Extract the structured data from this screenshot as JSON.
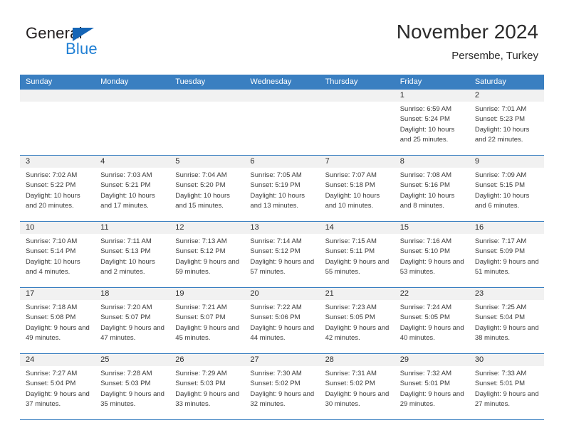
{
  "brand": {
    "name_part1": "General",
    "name_part2": "Blue",
    "triangle_color": "#1565b6",
    "blue_text_color": "#1f7fd4"
  },
  "header": {
    "title": "November 2024",
    "subtitle": "Persembe, Turkey",
    "header_bg_color": "#3a7fc1"
  },
  "weekdays": [
    "Sunday",
    "Monday",
    "Tuesday",
    "Wednesday",
    "Thursday",
    "Friday",
    "Saturday"
  ],
  "weeks": [
    [
      {
        "empty": true
      },
      {
        "empty": true
      },
      {
        "empty": true
      },
      {
        "empty": true
      },
      {
        "empty": true
      },
      {
        "day": "1",
        "sunrise": "Sunrise: 6:59 AM",
        "sunset": "Sunset: 5:24 PM",
        "daylight": "Daylight: 10 hours and 25 minutes."
      },
      {
        "day": "2",
        "sunrise": "Sunrise: 7:01 AM",
        "sunset": "Sunset: 5:23 PM",
        "daylight": "Daylight: 10 hours and 22 minutes."
      }
    ],
    [
      {
        "day": "3",
        "sunrise": "Sunrise: 7:02 AM",
        "sunset": "Sunset: 5:22 PM",
        "daylight": "Daylight: 10 hours and 20 minutes."
      },
      {
        "day": "4",
        "sunrise": "Sunrise: 7:03 AM",
        "sunset": "Sunset: 5:21 PM",
        "daylight": "Daylight: 10 hours and 17 minutes."
      },
      {
        "day": "5",
        "sunrise": "Sunrise: 7:04 AM",
        "sunset": "Sunset: 5:20 PM",
        "daylight": "Daylight: 10 hours and 15 minutes."
      },
      {
        "day": "6",
        "sunrise": "Sunrise: 7:05 AM",
        "sunset": "Sunset: 5:19 PM",
        "daylight": "Daylight: 10 hours and 13 minutes."
      },
      {
        "day": "7",
        "sunrise": "Sunrise: 7:07 AM",
        "sunset": "Sunset: 5:18 PM",
        "daylight": "Daylight: 10 hours and 10 minutes."
      },
      {
        "day": "8",
        "sunrise": "Sunrise: 7:08 AM",
        "sunset": "Sunset: 5:16 PM",
        "daylight": "Daylight: 10 hours and 8 minutes."
      },
      {
        "day": "9",
        "sunrise": "Sunrise: 7:09 AM",
        "sunset": "Sunset: 5:15 PM",
        "daylight": "Daylight: 10 hours and 6 minutes."
      }
    ],
    [
      {
        "day": "10",
        "sunrise": "Sunrise: 7:10 AM",
        "sunset": "Sunset: 5:14 PM",
        "daylight": "Daylight: 10 hours and 4 minutes."
      },
      {
        "day": "11",
        "sunrise": "Sunrise: 7:11 AM",
        "sunset": "Sunset: 5:13 PM",
        "daylight": "Daylight: 10 hours and 2 minutes."
      },
      {
        "day": "12",
        "sunrise": "Sunrise: 7:13 AM",
        "sunset": "Sunset: 5:12 PM",
        "daylight": "Daylight: 9 hours and 59 minutes."
      },
      {
        "day": "13",
        "sunrise": "Sunrise: 7:14 AM",
        "sunset": "Sunset: 5:12 PM",
        "daylight": "Daylight: 9 hours and 57 minutes."
      },
      {
        "day": "14",
        "sunrise": "Sunrise: 7:15 AM",
        "sunset": "Sunset: 5:11 PM",
        "daylight": "Daylight: 9 hours and 55 minutes."
      },
      {
        "day": "15",
        "sunrise": "Sunrise: 7:16 AM",
        "sunset": "Sunset: 5:10 PM",
        "daylight": "Daylight: 9 hours and 53 minutes."
      },
      {
        "day": "16",
        "sunrise": "Sunrise: 7:17 AM",
        "sunset": "Sunset: 5:09 PM",
        "daylight": "Daylight: 9 hours and 51 minutes."
      }
    ],
    [
      {
        "day": "17",
        "sunrise": "Sunrise: 7:18 AM",
        "sunset": "Sunset: 5:08 PM",
        "daylight": "Daylight: 9 hours and 49 minutes."
      },
      {
        "day": "18",
        "sunrise": "Sunrise: 7:20 AM",
        "sunset": "Sunset: 5:07 PM",
        "daylight": "Daylight: 9 hours and 47 minutes."
      },
      {
        "day": "19",
        "sunrise": "Sunrise: 7:21 AM",
        "sunset": "Sunset: 5:07 PM",
        "daylight": "Daylight: 9 hours and 45 minutes."
      },
      {
        "day": "20",
        "sunrise": "Sunrise: 7:22 AM",
        "sunset": "Sunset: 5:06 PM",
        "daylight": "Daylight: 9 hours and 44 minutes."
      },
      {
        "day": "21",
        "sunrise": "Sunrise: 7:23 AM",
        "sunset": "Sunset: 5:05 PM",
        "daylight": "Daylight: 9 hours and 42 minutes."
      },
      {
        "day": "22",
        "sunrise": "Sunrise: 7:24 AM",
        "sunset": "Sunset: 5:05 PM",
        "daylight": "Daylight: 9 hours and 40 minutes."
      },
      {
        "day": "23",
        "sunrise": "Sunrise: 7:25 AM",
        "sunset": "Sunset: 5:04 PM",
        "daylight": "Daylight: 9 hours and 38 minutes."
      }
    ],
    [
      {
        "day": "24",
        "sunrise": "Sunrise: 7:27 AM",
        "sunset": "Sunset: 5:04 PM",
        "daylight": "Daylight: 9 hours and 37 minutes."
      },
      {
        "day": "25",
        "sunrise": "Sunrise: 7:28 AM",
        "sunset": "Sunset: 5:03 PM",
        "daylight": "Daylight: 9 hours and 35 minutes."
      },
      {
        "day": "26",
        "sunrise": "Sunrise: 7:29 AM",
        "sunset": "Sunset: 5:03 PM",
        "daylight": "Daylight: 9 hours and 33 minutes."
      },
      {
        "day": "27",
        "sunrise": "Sunrise: 7:30 AM",
        "sunset": "Sunset: 5:02 PM",
        "daylight": "Daylight: 9 hours and 32 minutes."
      },
      {
        "day": "28",
        "sunrise": "Sunrise: 7:31 AM",
        "sunset": "Sunset: 5:02 PM",
        "daylight": "Daylight: 9 hours and 30 minutes."
      },
      {
        "day": "29",
        "sunrise": "Sunrise: 7:32 AM",
        "sunset": "Sunset: 5:01 PM",
        "daylight": "Daylight: 9 hours and 29 minutes."
      },
      {
        "day": "30",
        "sunrise": "Sunrise: 7:33 AM",
        "sunset": "Sunset: 5:01 PM",
        "daylight": "Daylight: 9 hours and 27 minutes."
      }
    ]
  ]
}
